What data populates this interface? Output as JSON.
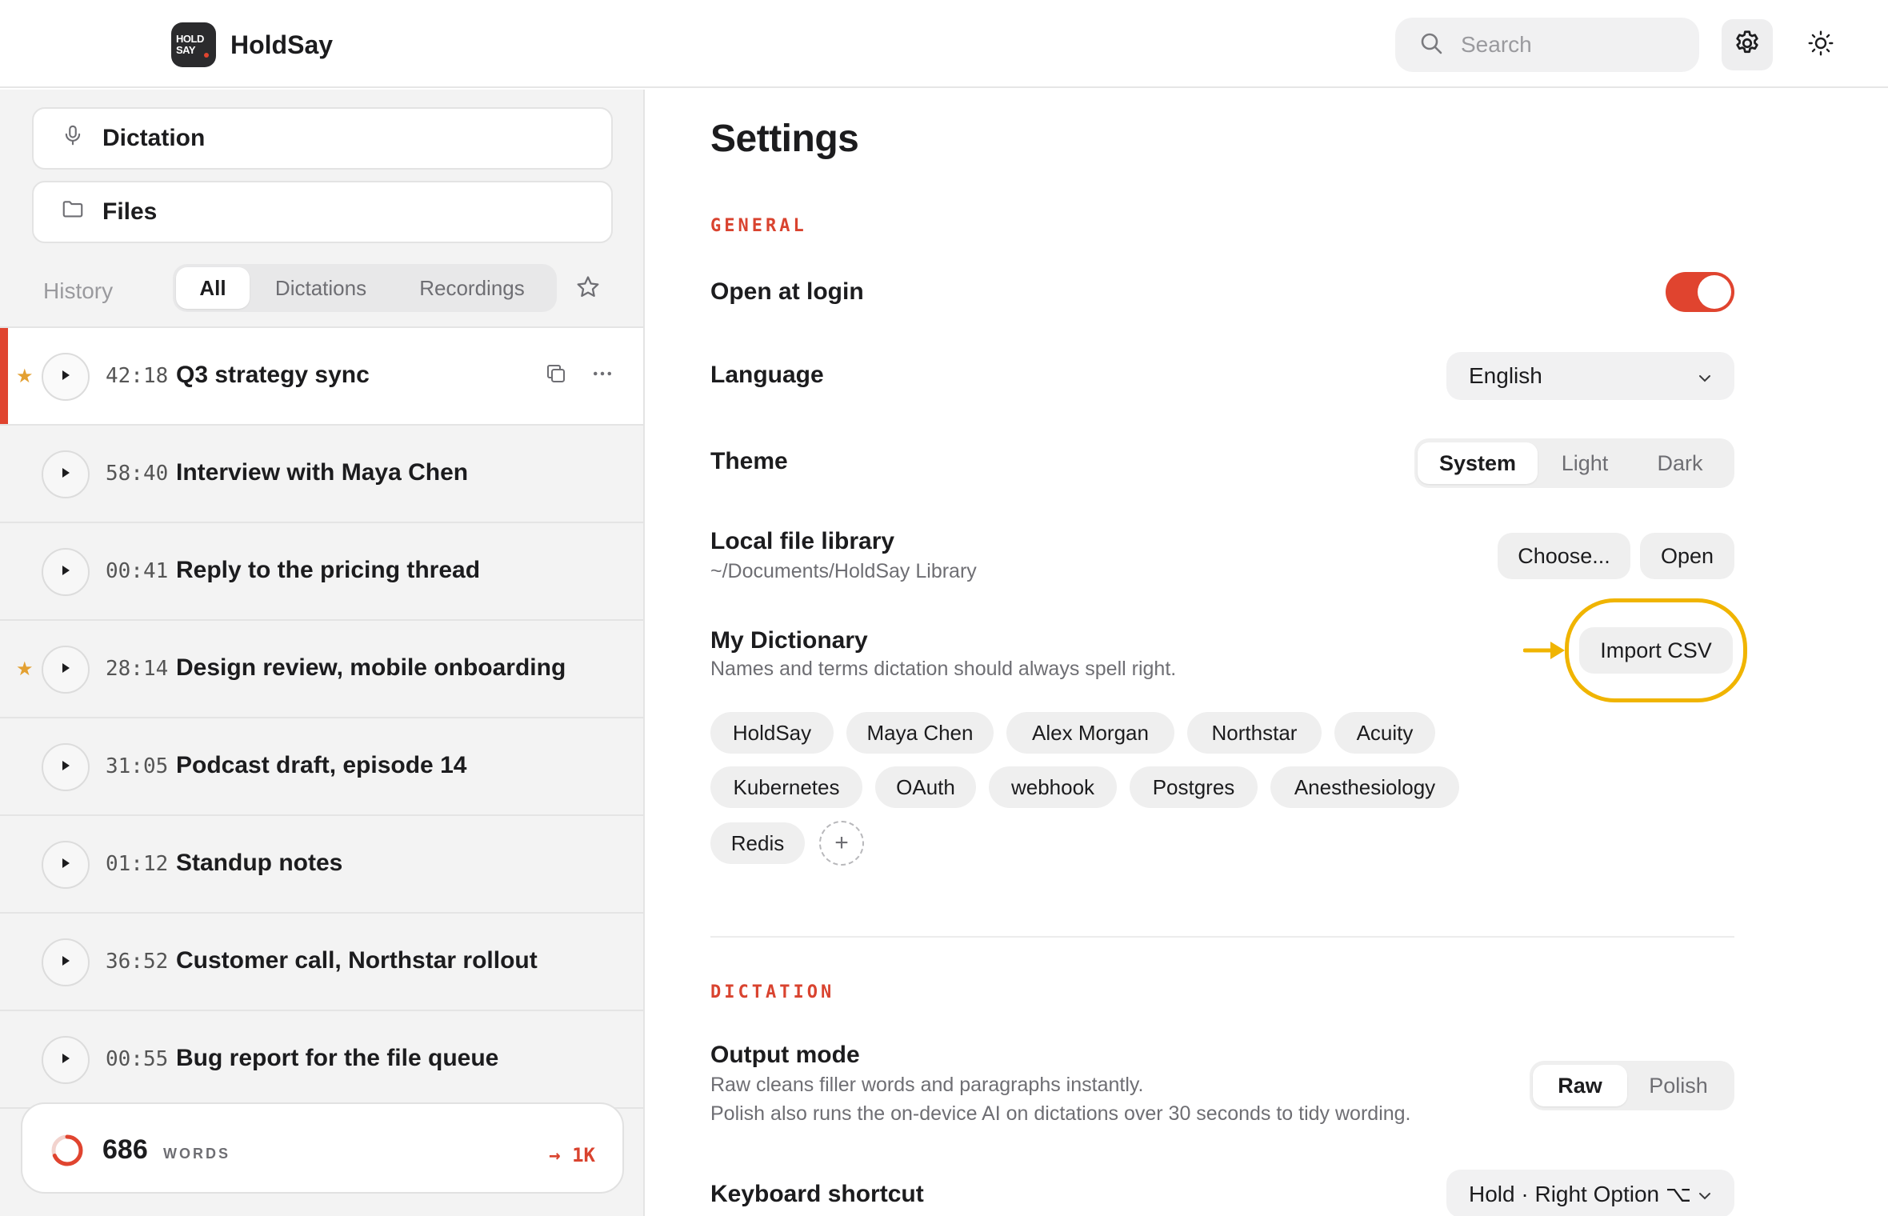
{
  "app": {
    "name": "HoldSay",
    "logo_line1": "HOLD",
    "logo_line2": "SAY"
  },
  "header": {
    "search_placeholder": "Search",
    "icons": {
      "search": "search-icon",
      "settings": "gear-icon",
      "theme": "sun-icon"
    }
  },
  "sidebar": {
    "nav": [
      {
        "label": "Dictation",
        "icon": "microphone-icon"
      },
      {
        "label": "Files",
        "icon": "folder-icon"
      }
    ],
    "history_label": "History",
    "filters": [
      {
        "label": "All",
        "active": true
      },
      {
        "label": "Dictations",
        "active": false
      },
      {
        "label": "Recordings",
        "active": false
      }
    ],
    "items": [
      {
        "duration": "42:18",
        "title": "Q3 strategy sync",
        "starred": true,
        "active": true
      },
      {
        "duration": "58:40",
        "title": "Interview with Maya Chen",
        "starred": false,
        "active": false
      },
      {
        "duration": "00:41",
        "title": "Reply to the pricing thread",
        "starred": false,
        "active": false
      },
      {
        "duration": "28:14",
        "title": "Design review, mobile onboarding",
        "starred": true,
        "active": false
      },
      {
        "duration": "31:05",
        "title": "Podcast draft, episode 14",
        "starred": false,
        "active": false
      },
      {
        "duration": "01:12",
        "title": "Standup notes",
        "starred": false,
        "active": false
      },
      {
        "duration": "36:52",
        "title": "Customer call, Northstar rollout",
        "starred": false,
        "active": false
      },
      {
        "duration": "00:55",
        "title": "Bug report for the file queue",
        "starred": false,
        "active": false
      }
    ],
    "words": {
      "count": "686",
      "label": "WORDS",
      "goal": "→ 1K",
      "progress": 0.686
    }
  },
  "settings": {
    "title": "Settings",
    "general": {
      "label": "GENERAL",
      "open_at_login": {
        "label": "Open at login",
        "enabled": true
      },
      "language": {
        "label": "Language",
        "value": "English"
      },
      "theme": {
        "label": "Theme",
        "options": [
          "System",
          "Light",
          "Dark"
        ],
        "selected": "System"
      },
      "library": {
        "label": "Local file library",
        "path": "~/Documents/HoldSay Library",
        "choose": "Choose...",
        "open": "Open"
      },
      "dictionary": {
        "label": "My Dictionary",
        "desc": "Names and terms dictation should always spell right.",
        "import": "Import CSV",
        "terms": [
          "HoldSay",
          "Maya Chen",
          "Alex Morgan",
          "Northstar",
          "Acuity",
          "Kubernetes",
          "OAuth",
          "webhook",
          "Postgres",
          "Anesthesiology",
          "Redis"
        ],
        "add": "+"
      }
    },
    "dictation": {
      "label": "DICTATION",
      "output_mode": {
        "label": "Output mode",
        "desc1": "Raw cleans filler words and paragraphs instantly.",
        "desc2": "Polish also runs the on-device AI on dictations over 30 seconds to tidy wording.",
        "options": [
          "Raw",
          "Polish"
        ],
        "selected": "Raw"
      },
      "shortcut": {
        "label": "Keyboard shortcut",
        "value": "Hold · Right Option ⌥"
      }
    }
  },
  "colors": {
    "accent": "#e0442f",
    "highlight": "#f0b400",
    "star": "#e3a031"
  }
}
